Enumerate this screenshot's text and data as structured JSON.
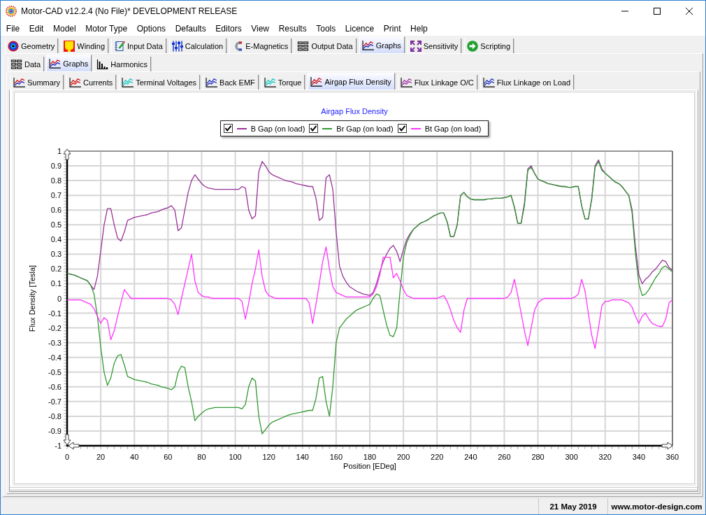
{
  "window": {
    "title": "Motor-CAD v12.2.4 (No File)* DEVELOPMENT RELEASE"
  },
  "menu_bar": [
    "File",
    "Edit",
    "Model",
    "Motor Type",
    "Options",
    "Defaults",
    "Editors",
    "View",
    "Results",
    "Tools",
    "Licence",
    "Print",
    "Help"
  ],
  "main_tabs": [
    {
      "label": "Geometry",
      "selected": false
    },
    {
      "label": "Winding",
      "selected": false
    },
    {
      "label": "Input Data",
      "selected": false
    },
    {
      "label": "Calculation",
      "selected": false
    },
    {
      "label": "E-Magnetics",
      "selected": false
    },
    {
      "label": "Output Data",
      "selected": false
    },
    {
      "label": "Graphs",
      "selected": true
    },
    {
      "label": "Sensitivity",
      "selected": false
    },
    {
      "label": "Scripting",
      "selected": false
    }
  ],
  "graph_view_tabs": [
    {
      "label": "Data",
      "selected": false
    },
    {
      "label": "Graphs",
      "selected": true
    },
    {
      "label": "Harmonics",
      "selected": false
    }
  ],
  "result_tabs": [
    {
      "label": "Summary",
      "selected": false
    },
    {
      "label": "Currents",
      "selected": false
    },
    {
      "label": "Terminal Voltages",
      "selected": false
    },
    {
      "label": "Back EMF",
      "selected": false
    },
    {
      "label": "Torque",
      "selected": false
    },
    {
      "label": "Airgap Flux Density",
      "selected": true
    },
    {
      "label": "Flux Linkage O/C",
      "selected": false
    },
    {
      "label": "Flux Linkage on Load",
      "selected": false
    }
  ],
  "graph": {
    "legend_checkboxes": [
      {
        "checked": true
      },
      {
        "checked": true
      },
      {
        "checked": true
      }
    ],
    "chart_data": {
      "type": "line",
      "title": "Airgap Flux Density",
      "legend": "top",
      "grid": true,
      "xlabel": "Position [EDeg]",
      "ylabel": "Flux Density [Tesla]",
      "xlim": [
        0,
        360
      ],
      "ylim": [
        -1,
        1
      ],
      "xticks": [
        0,
        20,
        40,
        60,
        80,
        100,
        120,
        140,
        160,
        180,
        200,
        220,
        240,
        260,
        280,
        300,
        320,
        340,
        360
      ],
      "yticks": [
        -1,
        -0.9,
        -0.8,
        -0.7,
        -0.6,
        -0.5,
        -0.4,
        -0.3,
        -0.2,
        -0.1,
        0,
        0.1,
        0.2,
        0.3,
        0.4,
        0.5,
        0.6,
        0.7,
        0.8,
        0.9,
        1
      ],
      "x": [
        0,
        2,
        4,
        6,
        8,
        10,
        12,
        14,
        16,
        18,
        20,
        22,
        24,
        26,
        28,
        30,
        32,
        34,
        36,
        38,
        40,
        42,
        44,
        46,
        48,
        50,
        52,
        54,
        56,
        58,
        60,
        62,
        64,
        66,
        68,
        70,
        72,
        74,
        76,
        78,
        80,
        82,
        84,
        86,
        88,
        90,
        92,
        94,
        96,
        98,
        100,
        102,
        104,
        106,
        108,
        110,
        112,
        114,
        116,
        118,
        120,
        122,
        124,
        126,
        128,
        130,
        132,
        134,
        136,
        138,
        140,
        142,
        144,
        146,
        148,
        150,
        152,
        154,
        156,
        158,
        160,
        162,
        164,
        166,
        168,
        170,
        172,
        174,
        176,
        178,
        180,
        182,
        184,
        186,
        188,
        190,
        192,
        194,
        196,
        198,
        200,
        202,
        204,
        206,
        208,
        210,
        212,
        214,
        216,
        218,
        220,
        222,
        224,
        226,
        228,
        230,
        232,
        234,
        236,
        238,
        240,
        242,
        244,
        246,
        248,
        250,
        252,
        254,
        256,
        258,
        260,
        262,
        264,
        266,
        268,
        270,
        272,
        274,
        276,
        278,
        280,
        282,
        284,
        286,
        288,
        290,
        292,
        294,
        296,
        298,
        300,
        302,
        304,
        306,
        308,
        310,
        312,
        314,
        316,
        318,
        320,
        322,
        324,
        326,
        328,
        330,
        332,
        334,
        336,
        338,
        340,
        342,
        344,
        346,
        348,
        350,
        352,
        354,
        356,
        358,
        360
      ],
      "series": [
        {
          "name": "B Gap (on load)",
          "color": "#993399",
          "values": [
            0.17,
            0.165,
            0.16,
            0.15,
            0.14,
            0.13,
            0.12,
            0.09,
            0.06,
            0.15,
            0.32,
            0.5,
            0.61,
            0.61,
            0.5,
            0.41,
            0.39,
            0.45,
            0.53,
            0.54,
            0.55,
            0.555,
            0.56,
            0.565,
            0.57,
            0.58,
            0.585,
            0.59,
            0.6,
            0.61,
            0.615,
            0.63,
            0.6,
            0.46,
            0.48,
            0.6,
            0.72,
            0.8,
            0.84,
            0.81,
            0.78,
            0.76,
            0.75,
            0.745,
            0.74,
            0.74,
            0.74,
            0.74,
            0.74,
            0.74,
            0.74,
            0.74,
            0.76,
            0.75,
            0.6,
            0.54,
            0.56,
            0.86,
            0.93,
            0.9,
            0.86,
            0.84,
            0.83,
            0.82,
            0.81,
            0.8,
            0.795,
            0.79,
            0.78,
            0.775,
            0.77,
            0.765,
            0.76,
            0.76,
            0.68,
            0.53,
            0.55,
            0.82,
            0.84,
            0.74,
            0.45,
            0.22,
            0.15,
            0.11,
            0.08,
            0.065,
            0.05,
            0.04,
            0.03,
            0.025,
            0.02,
            0.04,
            0.1,
            0.18,
            0.25,
            0.3,
            0.34,
            0.36,
            0.32,
            0.25,
            0.33,
            0.4,
            0.44,
            0.47,
            0.49,
            0.51,
            0.52,
            0.53,
            0.545,
            0.56,
            0.57,
            0.58,
            0.58,
            0.52,
            0.42,
            0.42,
            0.5,
            0.7,
            0.72,
            0.69,
            0.675,
            0.67,
            0.67,
            0.67,
            0.67,
            0.675,
            0.675,
            0.68,
            0.68,
            0.68,
            0.685,
            0.69,
            0.7,
            0.62,
            0.51,
            0.51,
            0.65,
            0.88,
            0.9,
            0.85,
            0.81,
            0.8,
            0.79,
            0.78,
            0.775,
            0.77,
            0.765,
            0.76,
            0.76,
            0.755,
            0.755,
            0.76,
            0.76,
            0.63,
            0.54,
            0.54,
            0.68,
            0.9,
            0.94,
            0.88,
            0.85,
            0.83,
            0.81,
            0.79,
            0.78,
            0.76,
            0.73,
            0.7,
            0.6,
            0.35,
            0.16,
            0.1,
            0.13,
            0.15,
            0.18,
            0.2,
            0.23,
            0.26,
            0.25,
            0.21,
            0.19
          ]
        },
        {
          "name": "Br Gap (on load)",
          "color": "#339933",
          "values": [
            0.17,
            0.165,
            0.16,
            0.15,
            0.14,
            0.13,
            0.12,
            0.09,
            0.03,
            -0.12,
            -0.33,
            -0.5,
            -0.59,
            -0.54,
            -0.44,
            -0.39,
            -0.38,
            -0.45,
            -0.53,
            -0.54,
            -0.55,
            -0.555,
            -0.56,
            -0.565,
            -0.57,
            -0.58,
            -0.585,
            -0.59,
            -0.6,
            -0.605,
            -0.61,
            -0.62,
            -0.6,
            -0.5,
            -0.46,
            -0.47,
            -0.6,
            -0.7,
            -0.83,
            -0.8,
            -0.78,
            -0.76,
            -0.75,
            -0.745,
            -0.74,
            -0.74,
            -0.74,
            -0.74,
            -0.74,
            -0.74,
            -0.74,
            -0.74,
            -0.75,
            -0.72,
            -0.6,
            -0.54,
            -0.56,
            -0.8,
            -0.92,
            -0.89,
            -0.86,
            -0.84,
            -0.83,
            -0.82,
            -0.81,
            -0.8,
            -0.79,
            -0.785,
            -0.78,
            -0.775,
            -0.77,
            -0.765,
            -0.76,
            -0.76,
            -0.68,
            -0.54,
            -0.53,
            -0.7,
            -0.8,
            -0.6,
            -0.3,
            -0.2,
            -0.17,
            -0.14,
            -0.12,
            -0.1,
            -0.08,
            -0.07,
            -0.06,
            -0.05,
            -0.04,
            0.0,
            0.03,
            0.02,
            -0.08,
            -0.18,
            -0.25,
            -0.26,
            -0.2,
            0.05,
            0.28,
            0.38,
            0.43,
            0.47,
            0.49,
            0.51,
            0.52,
            0.53,
            0.545,
            0.56,
            0.57,
            0.58,
            0.58,
            0.52,
            0.42,
            0.42,
            0.5,
            0.7,
            0.72,
            0.69,
            0.675,
            0.67,
            0.67,
            0.67,
            0.67,
            0.675,
            0.675,
            0.68,
            0.68,
            0.68,
            0.685,
            0.69,
            0.7,
            0.62,
            0.51,
            0.51,
            0.63,
            0.87,
            0.89,
            0.85,
            0.81,
            0.8,
            0.79,
            0.78,
            0.775,
            0.77,
            0.765,
            0.76,
            0.76,
            0.755,
            0.755,
            0.76,
            0.76,
            0.63,
            0.54,
            0.54,
            0.67,
            0.89,
            0.93,
            0.87,
            0.85,
            0.83,
            0.81,
            0.79,
            0.78,
            0.76,
            0.73,
            0.7,
            0.58,
            0.3,
            0.1,
            0.02,
            0.03,
            0.06,
            0.1,
            0.14,
            0.17,
            0.21,
            0.22,
            0.2,
            0.18
          ]
        },
        {
          "name": "Bt Gap (on load)",
          "color": "#ff33ff",
          "values": [
            -0.01,
            -0.01,
            -0.01,
            -0.01,
            -0.01,
            -0.02,
            -0.03,
            -0.04,
            -0.07,
            -0.12,
            -0.17,
            -0.13,
            -0.15,
            -0.28,
            -0.22,
            -0.12,
            -0.03,
            0.06,
            0.03,
            0.0,
            0,
            0,
            0,
            0,
            0,
            0,
            0,
            0,
            0,
            0,
            0.0,
            -0.01,
            -0.04,
            -0.11,
            0.0,
            0.1,
            0.2,
            0.3,
            0.12,
            0.04,
            0.02,
            0.01,
            0.01,
            0,
            0,
            0,
            0,
            0,
            0,
            0,
            0,
            0,
            -0.02,
            -0.14,
            -0.03,
            0.1,
            0.2,
            0.33,
            0.15,
            0.05,
            0.02,
            0.01,
            0,
            0,
            0,
            0,
            0,
            0,
            0,
            0,
            0,
            0,
            -0.03,
            -0.17,
            -0.04,
            0.1,
            0.25,
            0.35,
            0.2,
            0.08,
            0.04,
            0.03,
            0.02,
            0.01,
            0.01,
            0.01,
            0.01,
            0.01,
            0.01,
            0.01,
            0.01,
            0.03,
            0.08,
            0.16,
            0.28,
            0.28,
            0.28,
            0.14,
            0.17,
            0.12,
            0.06,
            0.02,
            0.01,
            0,
            0,
            0,
            0,
            0,
            0,
            0,
            0,
            0.01,
            0.02,
            -0.02,
            -0.08,
            -0.15,
            -0.2,
            -0.23,
            -0.08,
            0,
            0,
            0,
            0,
            0,
            0,
            0,
            0,
            0,
            0,
            0,
            0,
            0.01,
            0.04,
            0.13,
            0.02,
            -0.1,
            -0.22,
            -0.32,
            -0.2,
            -0.08,
            -0.03,
            -0.01,
            0,
            0,
            0,
            0,
            0,
            0,
            0,
            0,
            0,
            0.01,
            0.03,
            0.13,
            0.05,
            -0.1,
            -0.25,
            -0.34,
            -0.2,
            -0.05,
            -0.02,
            -0.02,
            -0.01,
            -0.01,
            -0.01,
            -0.01,
            -0.02,
            -0.03,
            -0.06,
            -0.12,
            -0.17,
            -0.12,
            -0.1,
            -0.14,
            -0.17,
            -0.18,
            -0.19,
            -0.19,
            -0.14,
            -0.03,
            -0.01
          ]
        }
      ]
    }
  },
  "status_bar": {
    "date": "21 May 2019",
    "website": "www.motor-design.com"
  }
}
